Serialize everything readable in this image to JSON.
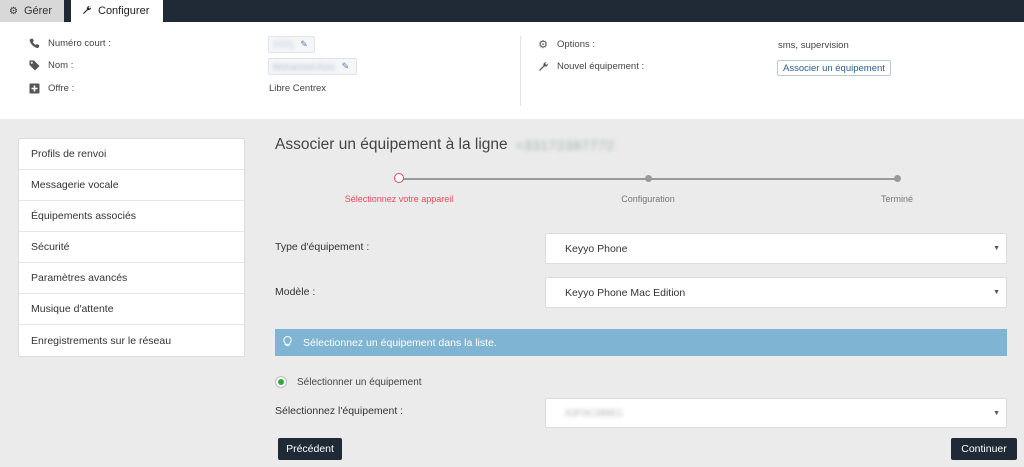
{
  "tabs": [
    {
      "label": "Gérer",
      "icon": "settings-cogs-icon"
    },
    {
      "label": "Configurer",
      "icon": "wrench-icon"
    }
  ],
  "info": {
    "numero_court": {
      "label": "Numéro court :",
      "value": "7771"
    },
    "nom": {
      "label": "Nom :",
      "value": "Mohamed Aziz"
    },
    "offre": {
      "label": "Offre :",
      "value": "Libre Centrex"
    },
    "options": {
      "label": "Options :",
      "value": "sms, supervision"
    },
    "nouvel_equipement": {
      "label": "Nouvel équipement :",
      "button": "Associer un équipement"
    }
  },
  "sidebar": {
    "items": [
      {
        "label": "Profils de renvoi"
      },
      {
        "label": "Messagerie vocale"
      },
      {
        "label": "Équipements associés"
      },
      {
        "label": "Sécurité"
      },
      {
        "label": "Paramètres avancés"
      },
      {
        "label": "Musique d'attente"
      },
      {
        "label": "Enregistrements sur le réseau"
      }
    ]
  },
  "main": {
    "title": "Associer un équipement à la ligne",
    "title_number": "+33172387772",
    "steps": [
      {
        "label": "Sélectionnez votre appareil",
        "state": "active"
      },
      {
        "label": "Configuration",
        "state": "pending"
      },
      {
        "label": "Terminé",
        "state": "pending"
      }
    ],
    "type_label": "Type d'équipement :",
    "type_value": "Keyyo Phone",
    "model_label": "Modèle :",
    "model_value": "Keyyo Phone Mac Edition",
    "alert": "Sélectionnez un équipement dans la liste.",
    "radio_label": "Sélectionner un équipement",
    "device_label": "Sélectionnez l'équipement :",
    "device_value": "A3F9C2B8E1",
    "btn_prev": "Précédent",
    "btn_next": "Continuer"
  },
  "colors": {
    "topbar": "#1f2a36",
    "accent_active_step": "#e14b5a",
    "alert_bg": "#7fb4d3",
    "radio_selected": "#2eaa3a"
  }
}
